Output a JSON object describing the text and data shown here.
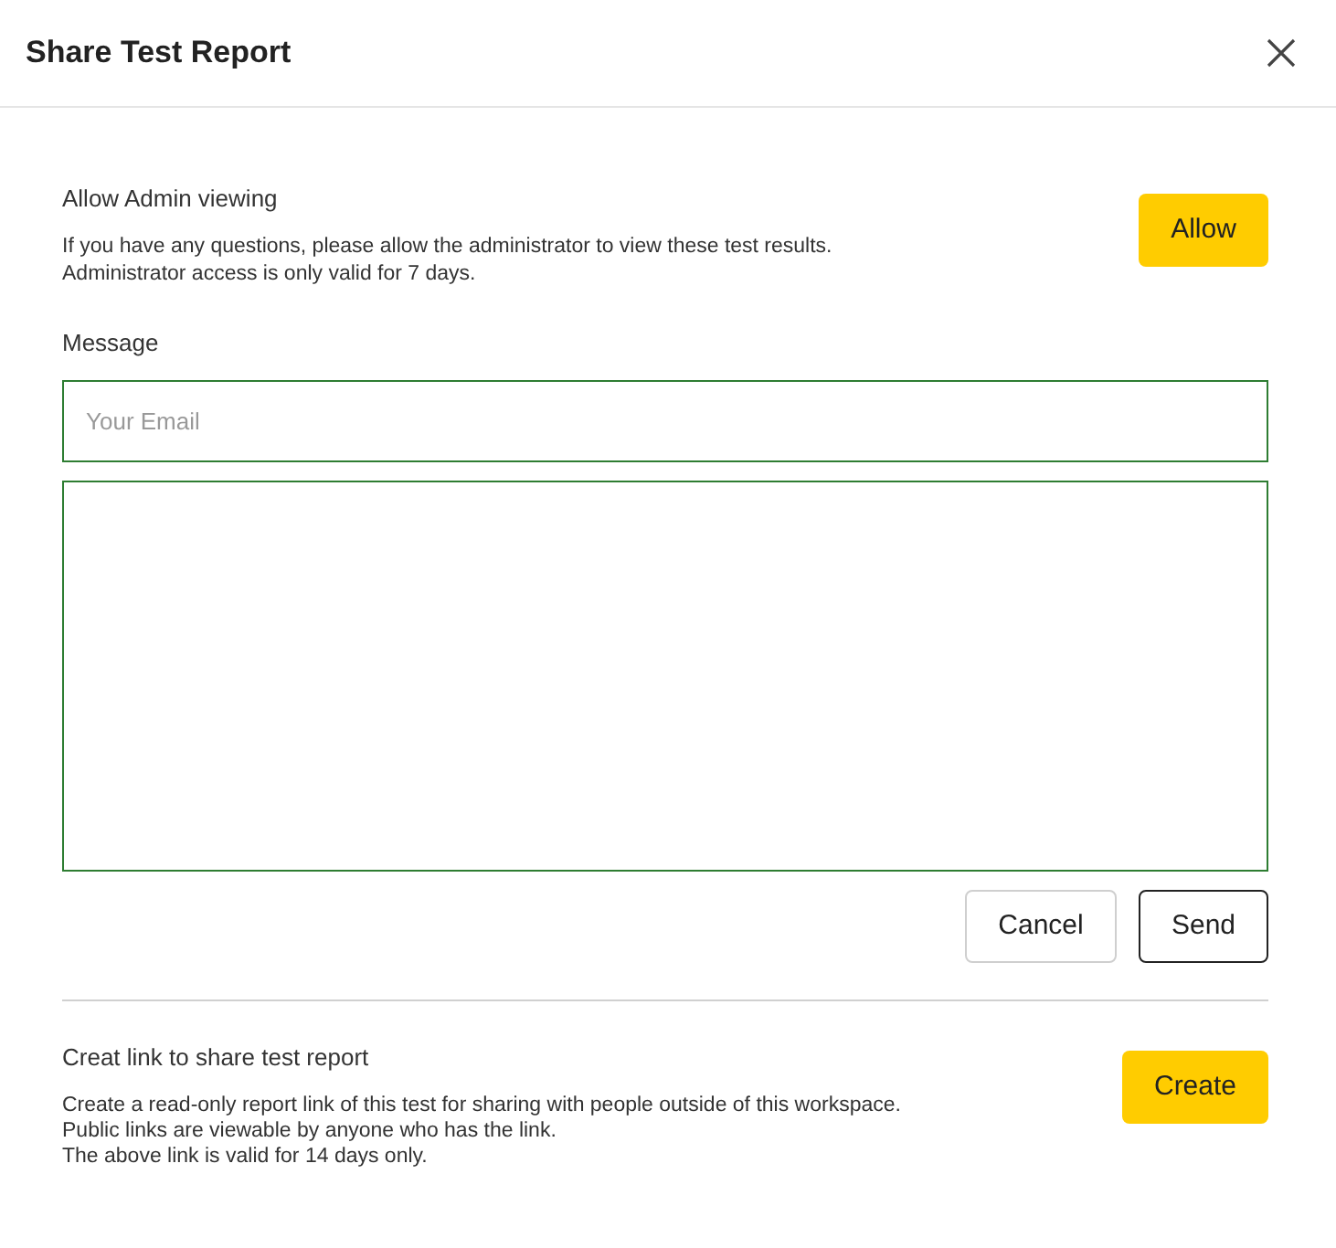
{
  "dialog": {
    "title": "Share Test Report"
  },
  "admin_section": {
    "heading": "Allow Admin viewing",
    "description_lines": [
      "If you have any questions, please allow the administrator to view these test results.",
      "Administrator access is only valid for 7 days."
    ],
    "button": "Allow"
  },
  "message_section": {
    "label": "Message",
    "email": {
      "placeholder": "Your Email"
    },
    "buttons": [
      {
        "label": "Cancel",
        "kind": "secondary"
      },
      {
        "label": "Send",
        "kind": "outlined"
      }
    ]
  },
  "link_section": {
    "heading": "Creat link to share test report",
    "description_lines": [
      "Create a read-only report link of this test for sharing with people outside of this workspace.",
      "Public links are viewable by anyone who has the link.",
      "The above link is valid for 14 days only."
    ],
    "button": "Create"
  }
}
